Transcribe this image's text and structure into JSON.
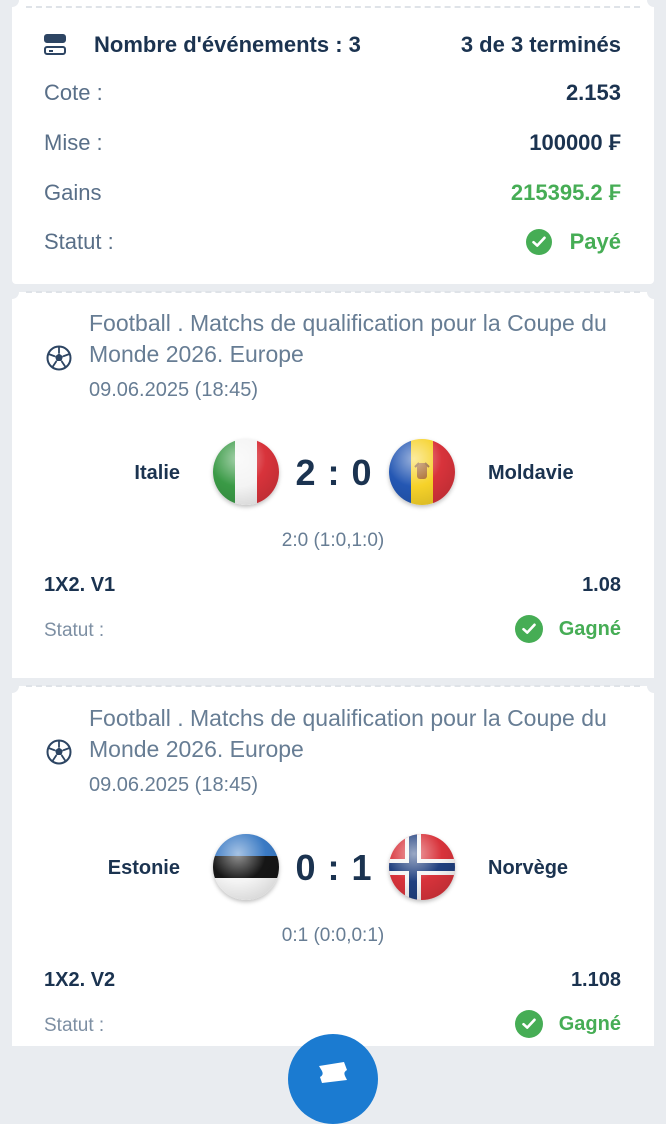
{
  "summary": {
    "title": "Nombre d'événements : 3",
    "count": "3 de 3 terminés",
    "cote_label": "Cote :",
    "cote_value": "2.153",
    "mise_label": "Mise :",
    "mise_value": "100000 ₣",
    "gains_label": "Gains",
    "gains_value": "215395.2 ₣",
    "statut_label": "Statut :",
    "statut_value": "Payé"
  },
  "events": [
    {
      "league": "Football . Matchs de qualification pour la Coupe du Monde 2026. Europe",
      "date": "09.06.2025 (18:45)",
      "home": "Italie",
      "away": "Moldavie",
      "score": "2 : 0",
      "detail": "2:0 (1:0,1:0)",
      "bet": "1X2. V1",
      "odd": "1.08",
      "status_label": "Statut :",
      "status_value": "Gagné"
    },
    {
      "league": "Football . Matchs de qualification pour la Coupe du Monde 2026. Europe",
      "date": "09.06.2025 (18:45)",
      "home": "Estonie",
      "away": "Norvège",
      "score": "0 : 1",
      "detail": "0:1 (0:0,0:1)",
      "bet": "1X2. V2",
      "odd": "1.108",
      "status_label": "Statut :",
      "status_value": "Gagné"
    }
  ],
  "icons": {
    "summary": "list-icon",
    "sport": "soccer-ball-icon",
    "status": "check-circle-icon",
    "fab": "ticket-icon"
  },
  "colors": {
    "win": "#46ad55",
    "text": "#1b3350",
    "muted": "#677d94",
    "accent": "#1b7bd1"
  }
}
